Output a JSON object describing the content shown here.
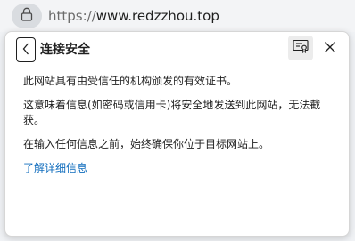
{
  "address_bar": {
    "url_scheme": "https://",
    "url_host": "www.redzzhou.top",
    "lock_icon": "lock-icon"
  },
  "panel": {
    "title": "连接安全",
    "back_icon": "chevron-left-icon",
    "cert_icon": "certificate-icon",
    "close_icon": "close-icon",
    "paragraphs": [
      "此网站具有由受信任的机构颁发的有效证书。",
      "这意味着信息(如密码或信用卡)将安全地发送到此网站，无法截获。",
      "在输入任何信息之前，始终确保你位于目标网站上。"
    ],
    "learn_more": "了解详细信息"
  },
  "colors": {
    "link": "#0f6cbd",
    "text": "#1f1f1f",
    "background": "#ffffff"
  }
}
